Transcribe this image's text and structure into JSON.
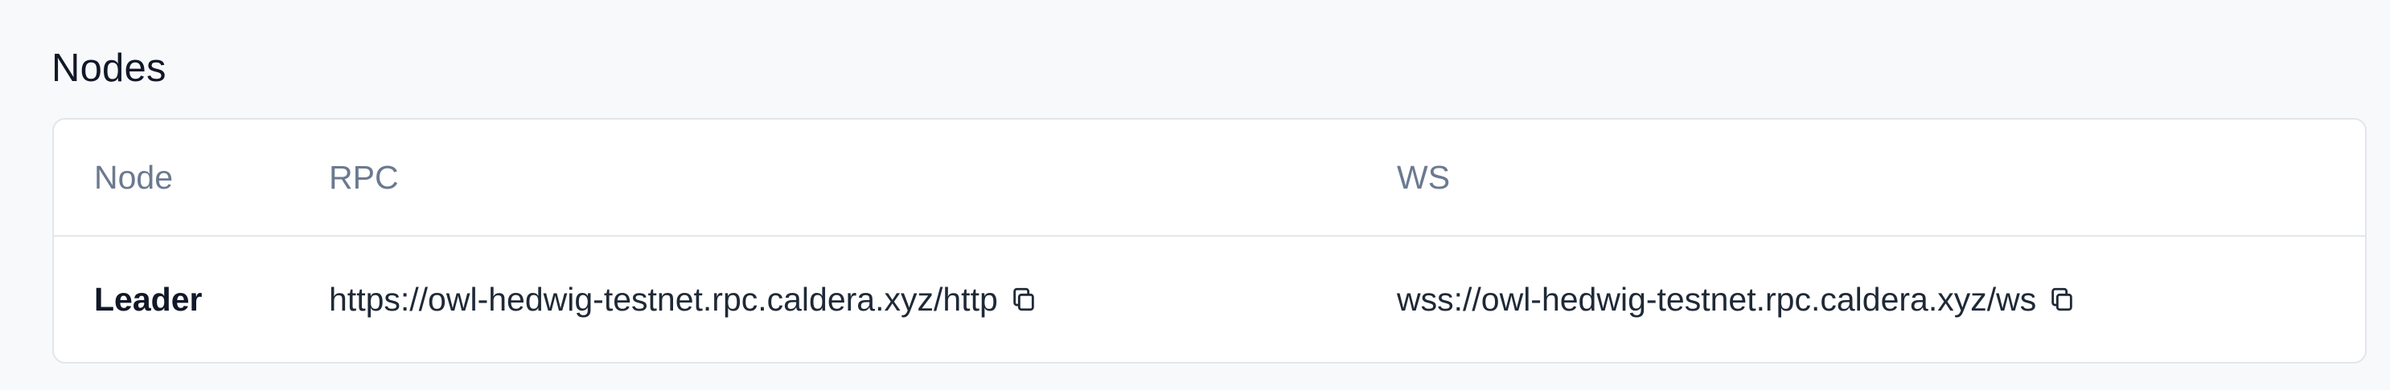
{
  "section": {
    "title": "Nodes"
  },
  "table": {
    "columns": [
      "Node",
      "RPC",
      "WS"
    ],
    "rows": [
      {
        "node": "Leader",
        "rpc": "https://owl-hedwig-testnet.rpc.caldera.xyz/http",
        "ws": "wss://owl-hedwig-testnet.rpc.caldera.xyz/ws"
      }
    ]
  },
  "icons": {
    "copy": "copy-icon"
  }
}
